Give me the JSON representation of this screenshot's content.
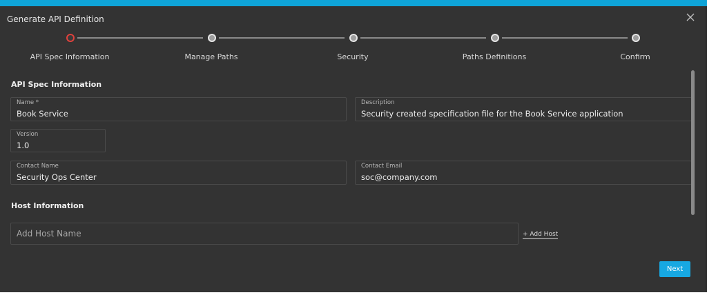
{
  "dialog": {
    "title": "Generate API Definition"
  },
  "stepper": {
    "steps": [
      {
        "label": "API Spec Information",
        "active": true
      },
      {
        "label": "Manage Paths",
        "active": false
      },
      {
        "label": "Security",
        "active": false
      },
      {
        "label": "Paths Definitions",
        "active": false
      },
      {
        "label": "Confirm",
        "active": false
      }
    ]
  },
  "api_spec": {
    "section_title": "API Spec Information",
    "name": {
      "label": "Name *",
      "value": "Book Service"
    },
    "description": {
      "label": "Description",
      "value": "Security created specification file for the Book Service application"
    },
    "version": {
      "label": "Version",
      "value": "1.0"
    },
    "contact_name": {
      "label": "Contact Name",
      "value": "Security Ops Center"
    },
    "contact_email": {
      "label": "Contact Email",
      "value": "soc@company.com"
    }
  },
  "host": {
    "section_title": "Host Information",
    "placeholder": "Add Host Name",
    "value": "",
    "add_label": "+ Add Host"
  },
  "footer": {
    "next_label": "Next"
  },
  "colors": {
    "accent": "#17a8e2",
    "topbar": "#0fa4d8",
    "active_step": "#e0413c",
    "background": "#333333"
  }
}
